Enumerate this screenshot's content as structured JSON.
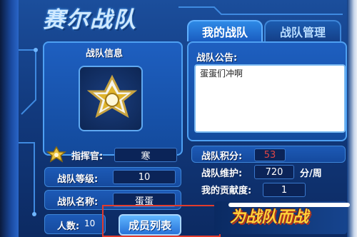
{
  "window": {
    "title": "赛尔战队"
  },
  "tabs": [
    {
      "label": "我的战队",
      "active": true
    },
    {
      "label": "战队管理",
      "active": false
    }
  ],
  "team_info": {
    "heading": "战队信息",
    "emblem_icon": "team-emblem-star-shield-icon",
    "commander_label": "指挥官:",
    "commander_value": "寒",
    "level_label": "战队等级:",
    "level_value": "10",
    "name_label": "战队名称:",
    "name_value": "蛋蛋",
    "count_label": "人数:",
    "count_value": "10",
    "member_list_button": "成员列表"
  },
  "announcement": {
    "heading": "战队公告:",
    "text": "蛋蛋们冲啊"
  },
  "stats": {
    "points_label": "战队积分:",
    "points_value": "53",
    "maintenance_label": "战队维护:",
    "maintenance_value": "720",
    "maintenance_unit": "分/周",
    "contribution_label": "我的贡献度:",
    "contribution_value": "1"
  },
  "slogan": "为战队而战",
  "colors": {
    "accent": "#4ea0f2",
    "highlight": "#e23b2c",
    "points": "#e04646",
    "slogan": "#ffd23a"
  }
}
